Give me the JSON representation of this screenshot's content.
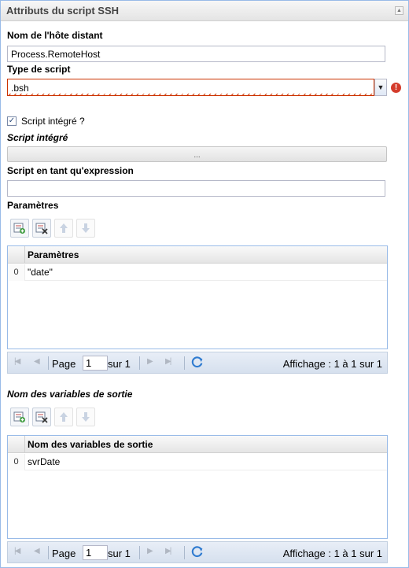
{
  "panel": {
    "title": "Attributs du script SSH"
  },
  "fields": {
    "remote_host_label": "Nom de l'hôte distant",
    "remote_host_value": "Process.RemoteHost",
    "script_type_label": "Type de script",
    "script_type_value": ".bsh",
    "embedded_checkbox_label": "Script intégré ?",
    "embedded_checked": true,
    "embedded_script_label": "Script intégré",
    "collapsed_text": "...",
    "script_expression_label": "Script en tant qu'expression",
    "script_expression_value": ""
  },
  "parameters": {
    "section_label": "Paramètres",
    "column_header": "Paramètres",
    "rows": [
      {
        "index": "0",
        "value": "\"date\""
      }
    ],
    "pager": {
      "page_label": "Page",
      "page_value": "1",
      "of_label": "sur 1",
      "display": "Affichage : 1 à 1 sur 1"
    }
  },
  "outputs": {
    "section_label": "Nom des variables de sortie",
    "column_header": "Nom des variables de sortie",
    "rows": [
      {
        "index": "0",
        "value": "svrDate"
      }
    ],
    "pager": {
      "page_label": "Page",
      "page_value": "1",
      "of_label": "sur 1",
      "display": "Affichage : 1 à 1 sur 1"
    }
  },
  "colors": {
    "panel_border": "#99bbe8",
    "error": "#cc3300",
    "pager_bg": "#dfe8f6"
  },
  "icons": [
    "collapse-icon",
    "combo-trigger-icon",
    "error-icon",
    "checkbox-icon",
    "add-row-icon",
    "delete-row-icon",
    "move-up-icon",
    "move-down-icon",
    "first-page-icon",
    "prev-page-icon",
    "next-page-icon",
    "last-page-icon",
    "refresh-icon"
  ]
}
